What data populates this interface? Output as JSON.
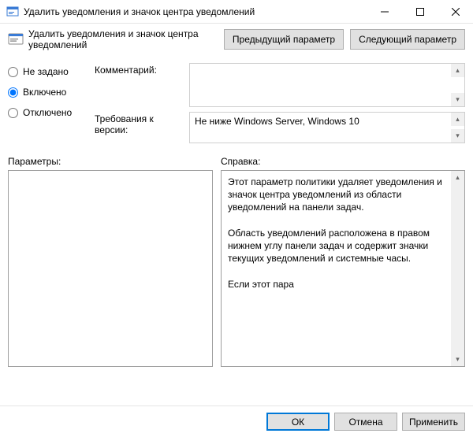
{
  "window": {
    "title": "Удалить уведомления и значок центра уведомлений"
  },
  "header": {
    "heading": "Удалить уведомления и значок центра уведомлений",
    "prev_button": "Предыдущий параметр",
    "next_button": "Следующий параметр"
  },
  "radios": {
    "not_configured": "Не задано",
    "enabled": "Включено",
    "disabled": "Отключено",
    "selected": "enabled"
  },
  "fields": {
    "comment_label": "Комментарий:",
    "comment_value": "",
    "supported_label": "Требования к версии:",
    "supported_value": "Не ниже Windows Server, Windows 10"
  },
  "panes": {
    "options_label": "Параметры:",
    "options_value": "",
    "help_label": "Справка:",
    "help_value": "Этот параметр политики удаляет уведомления и значок центра уведомлений из области уведомлений на панели задач.\n\nОбласть уведомлений расположена в правом нижнем углу панели задач и содержит значки текущих уведомлений и системные часы.\n\nЕсли этот пара"
  },
  "footer": {
    "ok": "ОК",
    "cancel": "Отмена",
    "apply": "Применить"
  }
}
